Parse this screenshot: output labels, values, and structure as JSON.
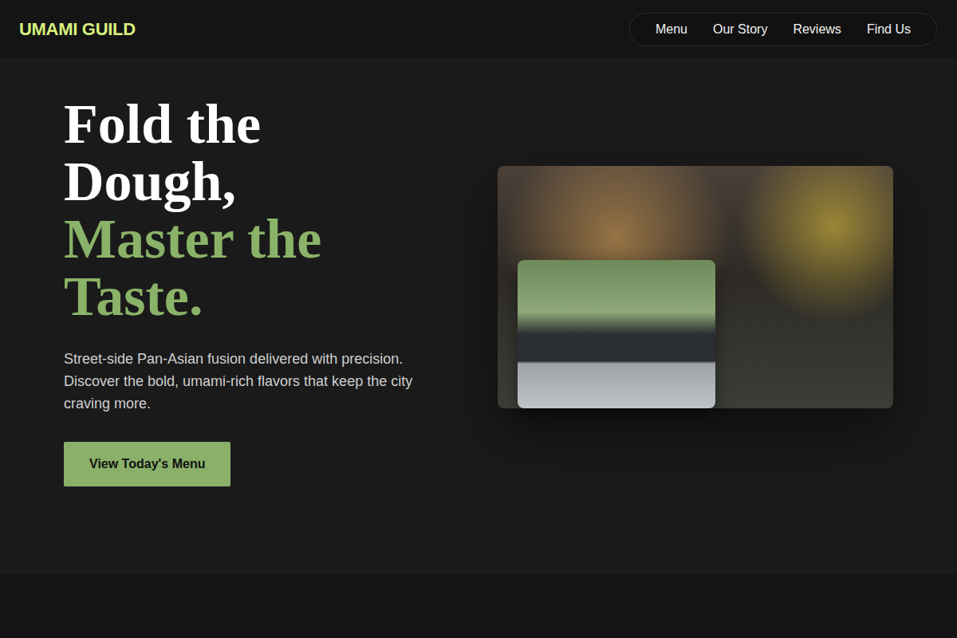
{
  "header": {
    "logo": "UMAMI GUILD",
    "nav": [
      {
        "label": "Menu"
      },
      {
        "label": "Our Story"
      },
      {
        "label": "Reviews"
      },
      {
        "label": "Find Us"
      }
    ]
  },
  "hero": {
    "title_lines": [
      {
        "text": "Fold the",
        "accent": false
      },
      {
        "text": "Dough,",
        "accent": false
      },
      {
        "text": "Master the",
        "accent": true
      },
      {
        "text": "Taste.",
        "accent": true
      }
    ],
    "description": "Street-side Pan-Asian fusion delivered with precision. Discover the bold, umami-rich flavors that keep the city craving more.",
    "button": "View Today's Menu"
  }
}
